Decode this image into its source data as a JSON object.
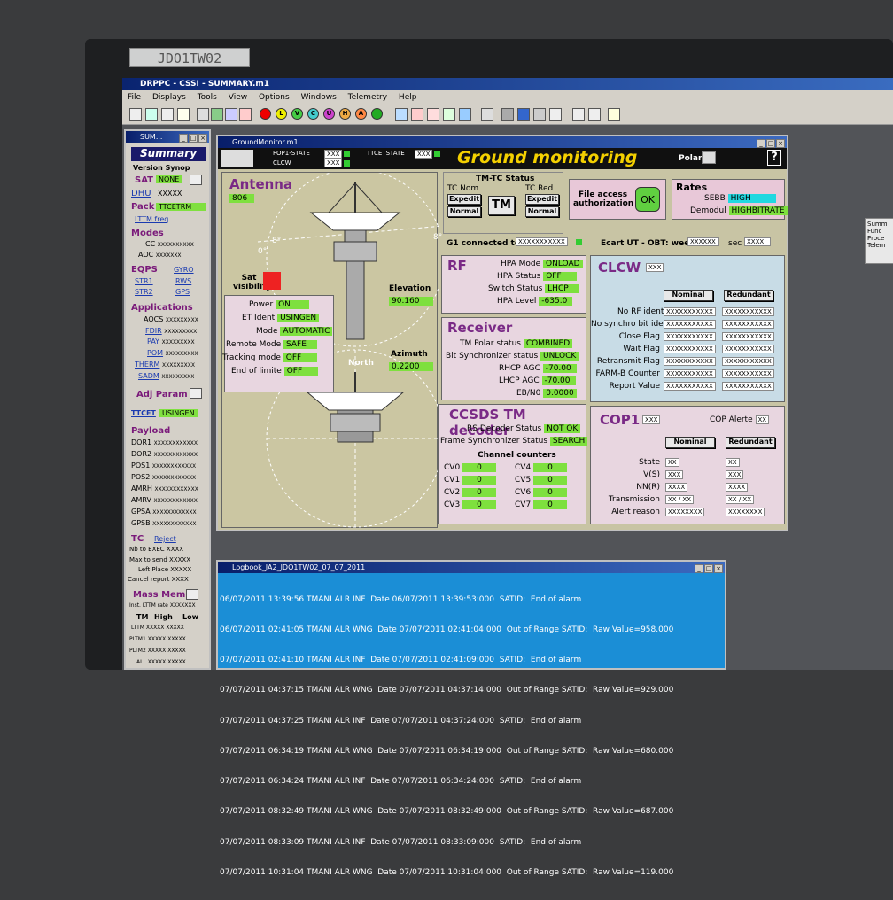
{
  "monitor_label": "JDO1TW02",
  "app": {
    "title": "DRPPC - CSSI - SUMMARY.m1",
    "menu": [
      "File",
      "Displays",
      "Tools",
      "View",
      "Options",
      "Windows",
      "Telemetry",
      "Help"
    ],
    "toolbar_letters": [
      "P",
      "L",
      "V",
      "C",
      "U",
      "H",
      "A"
    ]
  },
  "summary": {
    "win_title": "SUM...",
    "title": "Summary",
    "version": "Version Synop",
    "sat_label": "SAT",
    "sat_value": "NONE",
    "dhu_label": "DHU",
    "dhu_value": "XXXXX",
    "pack_label": "Pack",
    "pack_value": "TTCETRM",
    "ltm_freq": "LTTM freq",
    "modes_h": "Modes",
    "modes": [
      [
        "CC",
        "XXXXXXXXXX"
      ],
      [
        "AOC",
        "XXXXXXX"
      ]
    ],
    "eqps_h": "EQPS",
    "eqps": [
      "GYRO",
      "STR1",
      "RWS",
      "STR2",
      "GPS"
    ],
    "apps_h": "Applications",
    "apps": [
      [
        "AOCS",
        "XXXXXXXXX"
      ],
      [
        "FDIR",
        "XXXXXXXXX"
      ],
      [
        "PAY",
        "XXXXXXXXX"
      ],
      [
        "POM",
        "XXXXXXXXX"
      ],
      [
        "THERM",
        "XXXXXXXXX"
      ],
      [
        "SADM",
        "XXXXXXXXX"
      ]
    ],
    "adj": "Adj Param",
    "ttcet": "TTCET",
    "ttcet_value": "USINGEN",
    "payload_h": "Payload",
    "payload": [
      [
        "DOR1",
        "XXXXXXXXXXXX"
      ],
      [
        "DOR2",
        "XXXXXXXXXXXX"
      ],
      [
        "POS1",
        "XXXXXXXXXXXX"
      ],
      [
        "POS2",
        "XXXXXXXXXXXX"
      ],
      [
        "AMRH",
        "XXXXXXXXXXXX"
      ],
      [
        "AMRV",
        "XXXXXXXXXXXX"
      ],
      [
        "GPSA",
        "XXXXXXXXXXXX"
      ],
      [
        "GPSB",
        "XXXXXXXXXXXX"
      ]
    ],
    "tc_h": "TC",
    "reject": "Reject",
    "tc": [
      [
        "Nb to EXEC",
        "XXXX"
      ],
      [
        "Max to send",
        "XXXXX"
      ],
      [
        "Left Place",
        "XXXXX"
      ],
      [
        "Cancel report",
        "XXXX"
      ]
    ],
    "mass_h": "Mass Mem",
    "mass_rate": "Inst. LTTM rate",
    "mass_rate_v": "XXXXXXX",
    "mass_cols": [
      "TM",
      "High",
      "Low"
    ],
    "mass_rows": [
      "LTTM",
      "PLTM1",
      "PLTM2",
      "ALL"
    ],
    "mass_x": "XXXXX"
  },
  "gm": {
    "win_title": "GroundMonitor.m1",
    "title": "Ground monitoring",
    "fop": "FOP1-STATE",
    "clcw": "CLCW",
    "ttc": "TTCETSTATE",
    "xx": "XXX",
    "polar": "Polar",
    "help": "?",
    "antenna": {
      "h": "Antenna",
      "val": "806",
      "sat_vis": "Sat visibility",
      "elev_l": "Elevation",
      "elev_v": "90.160",
      "az_l": "Azimuth",
      "az_v": "0.2200",
      "north": "North",
      "deg8a": "8°",
      "deg8b": "8°",
      "deg0": "0°",
      "rows": [
        [
          "Power",
          "ON"
        ],
        [
          "ET Ident",
          "USINGEN"
        ],
        [
          "Mode",
          "AUTOMATIC"
        ],
        [
          "Remote Mode",
          "SAFE"
        ],
        [
          "Tracking mode",
          "OFF"
        ],
        [
          "End of limite",
          "OFF"
        ]
      ]
    },
    "tmtc": {
      "h": "TM-TC Status",
      "nom": "TC Nom",
      "red": "TC Red",
      "expedit": "Expedit",
      "normal": "Normal",
      "tm": "TM"
    },
    "file": {
      "l1": "File access",
      "l2": "authorization",
      "ok": "OK"
    },
    "rates": {
      "h": "Rates",
      "sebb": "SEBB",
      "sebb_v": "HIGH",
      "demod": "Demodul",
      "demod_v": "HIGHBITRATE"
    },
    "g1": "G1 connected to",
    "g1_v": "XXXXXXXXXXX",
    "ecart": "Ecart UT - OBT: week",
    "ecart_v": "XXXXXX",
    "sec": "sec",
    "sec_v": "XXXX",
    "rf": {
      "h": "RF",
      "rows": [
        [
          "HPA Mode",
          "ONLOAD"
        ],
        [
          "HPA Status",
          "OFF"
        ],
        [
          "Switch Status",
          "LHCP"
        ],
        [
          "HPA Level",
          "-635.0"
        ]
      ]
    },
    "rx": {
      "h": "Receiver",
      "rows": [
        [
          "TM Polar status",
          "COMBINED"
        ],
        [
          "Bit Synchronizer status",
          "UNLOCK"
        ],
        [
          "RHCP AGC",
          "-70.00"
        ],
        [
          "LHCP AGC",
          "-70.00"
        ],
        [
          "EB/N0",
          "0.0000"
        ]
      ]
    },
    "ccsds": {
      "h": "CCSDS TM decoder",
      "rows": [
        [
          "RS Decoder Status",
          "NOT OK"
        ],
        [
          "Frame Synchronizer Status",
          "SEARCH"
        ]
      ],
      "cc": "Channel counters",
      "cv": [
        [
          "CV0",
          "0"
        ],
        [
          "CV4",
          "0"
        ],
        [
          "CV1",
          "0"
        ],
        [
          "CV5",
          "0"
        ],
        [
          "CV2",
          "0"
        ],
        [
          "CV6",
          "0"
        ],
        [
          "CV3",
          "0"
        ],
        [
          "CV7",
          "0"
        ]
      ]
    },
    "clcw_p": {
      "h": "CLCW",
      "hv": "XXX",
      "nom": "Nominal",
      "red": "Redundant",
      "rows": [
        "No RF ident",
        "No synchro bit iden",
        "Close Flag",
        "Wait Flag",
        "Retransmit Flag",
        "FARM-B Counter",
        "Report Value"
      ],
      "x": "XXXXXXXXXXX"
    },
    "cop": {
      "h": "COP1",
      "hv": "XXX",
      "alert": "COP Alerte",
      "alert_v": "XX",
      "nom": "Nominal",
      "red": "Redundant",
      "rows": [
        [
          "State",
          "XX"
        ],
        [
          "V(S)",
          "XXX"
        ],
        [
          "NN(R)",
          "XXXX"
        ],
        [
          "Transmission",
          "XX / XX"
        ],
        [
          "Alert reason",
          "XXXXXXXX"
        ]
      ]
    }
  },
  "log": {
    "title": "Logbook_JA2_JDO1TW02_07_07_2011",
    "lines": [
      "06/07/2011 13:39:56 TMANI ALR INF  Date 06/07/2011 13:39:53:000  SATID:  End of alarm",
      "06/07/2011 02:41:05 TMANI ALR WNG  Date 07/07/2011 02:41:04:000  Out of Range SATID:  Raw Value=958.000",
      "07/07/2011 02:41:10 TMANI ALR INF  Date 07/07/2011 02:41:09:000  SATID:  End of alarm",
      "07/07/2011 04:37:15 TMANI ALR WNG  Date 07/07/2011 04:37:14:000  Out of Range SATID:  Raw Value=929.000",
      "07/07/2011 04:37:25 TMANI ALR INF  Date 07/07/2011 04:37:24:000  SATID:  End of alarm",
      "07/07/2011 06:34:19 TMANI ALR WNG  Date 07/07/2011 06:34:19:000  Out of Range SATID:  Raw Value=680.000",
      "07/07/2011 06:34:24 TMANI ALR INF  Date 07/07/2011 06:34:24:000  SATID:  End of alarm",
      "07/07/2011 08:32:49 TMANI ALR WNG  Date 07/07/2011 08:32:49:000  Out of Range SATID:  Raw Value=687.000",
      "07/07/2011 08:33:09 TMANI ALR INF  Date 07/07/2011 08:33:09:000  SATID:  End of alarm",
      "07/07/2011 10:31:04 TMANI ALR WNG  Date 07/07/2011 10:31:04:000  Out of Range SATID:  Raw Value=119.000"
    ]
  },
  "side": [
    "Summ",
    "Func",
    "Proce",
    "Telem"
  ]
}
